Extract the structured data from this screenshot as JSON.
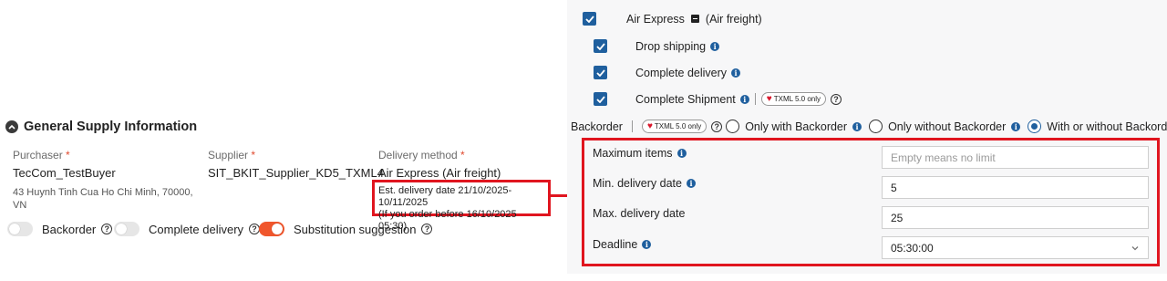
{
  "section": {
    "title": "General Supply Information"
  },
  "purchaser": {
    "label": "Purchaser",
    "value": "TecCom_TestBuyer",
    "address": "43 Huynh Tinh Cua Ho Chi Minh, 70000, VN"
  },
  "supplier": {
    "label": "Supplier",
    "value": "SIT_BKIT_Supplier_KD5_TXML4"
  },
  "delivery_method": {
    "label": "Delivery method",
    "value": "Air Express (Air freight)"
  },
  "estimate": {
    "line1": "Est. delivery date 21/10/2025-10/11/2025",
    "line2": "(If you order before 16/10/2025 05:30)"
  },
  "toggles": [
    {
      "label": "Backorder",
      "on": false
    },
    {
      "label": "Complete delivery",
      "on": false
    },
    {
      "label": "Substitution suggestion",
      "on": true
    }
  ],
  "panel": {
    "method_checkbox": {
      "label": "Air Express",
      "suffix": "(Air freight)"
    },
    "options": [
      {
        "label": "Drop shipping"
      },
      {
        "label": "Complete delivery"
      },
      {
        "label": "Complete Shipment"
      }
    ],
    "txml_badge": "TXML 5.0 only",
    "backorder": {
      "label": "Backorder",
      "choices": [
        "Only with Backorder",
        "Only without Backorder",
        "With or without Backorder"
      ],
      "selected": "With or without Backorder"
    },
    "fields": {
      "max_items": {
        "label": "Maximum items",
        "value": "",
        "placeholder": "Empty means no limit"
      },
      "min_delivery": {
        "label": "Min. delivery date",
        "value": "5"
      },
      "max_delivery": {
        "label": "Max. delivery date",
        "value": "25"
      },
      "deadline": {
        "label": "Deadline",
        "value": "05:30:00"
      }
    }
  },
  "colors": {
    "accent": "#1f5f9e",
    "toggle_on": "#f0562c",
    "highlight": "#e0151f"
  }
}
